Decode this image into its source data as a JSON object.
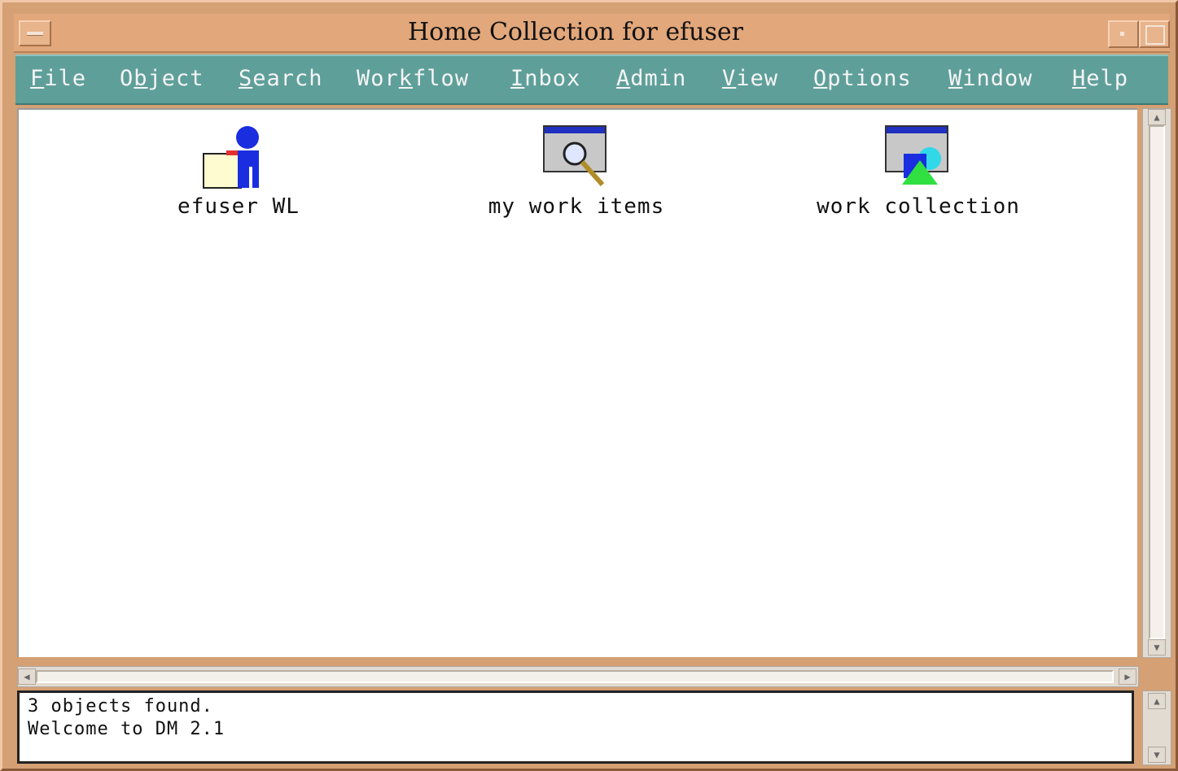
{
  "window": {
    "title": "Home Collection for efuser"
  },
  "menu": [
    {
      "mnemonic": "F",
      "rest": "ile"
    },
    {
      "pre": "O",
      "mnemonic": "b",
      "rest": "ject"
    },
    {
      "mnemonic": "S",
      "rest": "earch"
    },
    {
      "pre": "Wor",
      "mnemonic": "k",
      "rest": "flow"
    },
    {
      "mnemonic": "I",
      "rest": "nbox"
    },
    {
      "mnemonic": "A",
      "rest": "dmin"
    },
    {
      "mnemonic": "V",
      "rest": "iew"
    },
    {
      "mnemonic": "O",
      "rest": "ptions"
    },
    {
      "mnemonic": "W",
      "rest": "indow"
    },
    {
      "mnemonic": "H",
      "rest": "elp"
    }
  ],
  "items": [
    {
      "label": "efuser WL",
      "icon": "user-folder-icon"
    },
    {
      "label": "my work items",
      "icon": "search-window-icon"
    },
    {
      "label": "work collection",
      "icon": "collection-window-icon"
    }
  ],
  "status": {
    "line1": "3 objects found.",
    "line2": "Welcome to DM 2.1"
  }
}
